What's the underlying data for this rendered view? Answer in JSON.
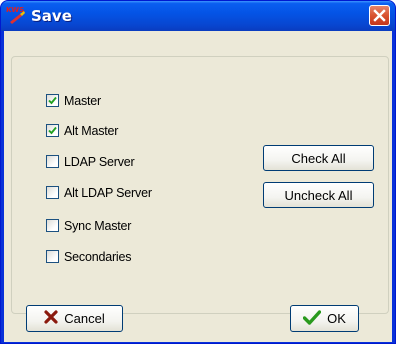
{
  "window": {
    "title": "Save",
    "icon_text": "KWS",
    "icon": "kws-app-icon",
    "close_icon": "close-icon"
  },
  "options": [
    {
      "label": "Master",
      "checked": true
    },
    {
      "label": "Alt Master",
      "checked": true
    },
    {
      "label": "LDAP Server",
      "checked": false
    },
    {
      "label": "Alt LDAP Server",
      "checked": false
    },
    {
      "label": "Sync Master",
      "checked": false
    },
    {
      "label": "Secondaries",
      "checked": false
    }
  ],
  "buttons": {
    "check_all": "Check All",
    "uncheck_all": "Uncheck All",
    "cancel": "Cancel",
    "ok": "OK"
  },
  "colors": {
    "titlebar": "#0a5ef0",
    "close": "#d9532f",
    "check": "#21a121",
    "cancel_icon": "#8b1a0e",
    "ok_icon": "#2a9a1e"
  }
}
